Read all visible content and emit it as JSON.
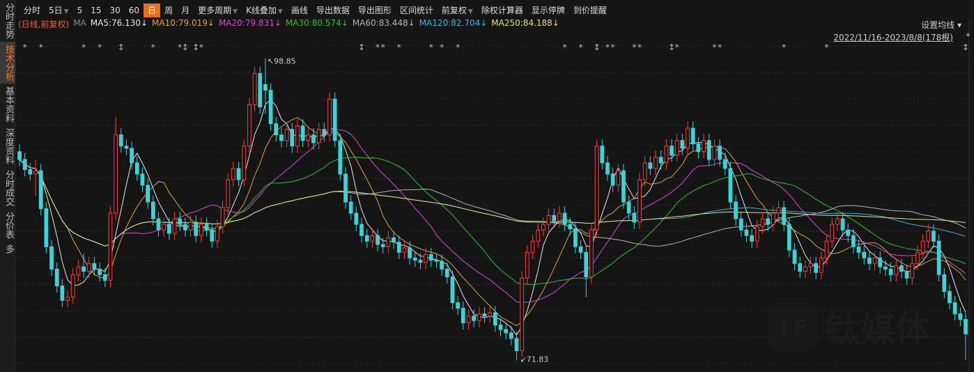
{
  "sidebar": {
    "items": [
      {
        "label": "分时走势",
        "active": false
      },
      {
        "label": "技术分析",
        "active": true
      },
      {
        "label": "基本资料",
        "active": false
      },
      {
        "label": "深度资料",
        "active": false
      },
      {
        "label": "分时成交",
        "active": false
      },
      {
        "label": "分价表",
        "active": false
      },
      {
        "label": "多",
        "active": false
      }
    ]
  },
  "toolbar": {
    "items": [
      {
        "label": "分时"
      },
      {
        "label": "5日",
        "dropdown": true
      },
      {
        "label": "5"
      },
      {
        "label": "15"
      },
      {
        "label": "30"
      },
      {
        "label": "60"
      },
      {
        "label": "日",
        "active": true
      },
      {
        "label": "周"
      },
      {
        "label": "月"
      },
      {
        "label": "更多周期",
        "dropdown": true
      },
      {
        "label": "K线叠加",
        "dropdown": true
      },
      {
        "label": "画线"
      },
      {
        "label": "导出数据"
      },
      {
        "label": "导出图形"
      },
      {
        "label": "区间统计"
      },
      {
        "label": "前复权",
        "dropdown": true
      },
      {
        "label": "除权计算器"
      },
      {
        "label": "显示停牌"
      },
      {
        "label": "到价提醒"
      }
    ]
  },
  "legend": {
    "mode": "(日线,前复权)",
    "ma_label": "MA",
    "items": [
      {
        "label": "MA5:76.130↓",
        "color": "#e8e8e8",
        "period": 5
      },
      {
        "label": "MA10:79.019↓",
        "color": "#d8a63a",
        "period": 10
      },
      {
        "label": "MA20:79.831↓",
        "color": "#d44ad4",
        "period": 20
      },
      {
        "label": "MA30:80.574↓",
        "color": "#2fbf2f",
        "period": 30
      },
      {
        "label": "MA60:83.448↓",
        "color": "#b4b4b4",
        "period": 60
      },
      {
        "label": "MA120:82.704↓",
        "color": "#2ab6d8",
        "period": 120
      },
      {
        "label": "MA250:84.188↓",
        "color": "#e6de7a",
        "period": 250
      }
    ]
  },
  "set_ma": "设置均线 ▾",
  "date_range": "2022/11/16-2023/8/8(178根)",
  "watermark": "钛媒体",
  "colors": {
    "up": "#ff3b3b",
    "down": "#3dd3d6",
    "bg": "#151515",
    "grid": "#2e2e2e"
  },
  "chart_data": {
    "type": "candlestick",
    "title": "",
    "bars": 178,
    "ylim": [
      70.8,
      100.2
    ],
    "grid": true,
    "annotations": [
      {
        "bar": 46,
        "label": "98.85",
        "kind": "high"
      },
      {
        "bar": 93,
        "label": "71.83",
        "kind": "low"
      }
    ],
    "event_markers": [
      {
        "bar": 1,
        "g": "*"
      },
      {
        "bar": 4,
        "g": "*"
      },
      {
        "bar": 12,
        "g": "*"
      },
      {
        "bar": 15,
        "g": "*"
      },
      {
        "bar": 19,
        "g": "↕"
      },
      {
        "bar": 25,
        "g": "*"
      },
      {
        "bar": 30,
        "g": "*"
      },
      {
        "bar": 31,
        "g": "↕"
      },
      {
        "bar": 33,
        "g": "↕"
      },
      {
        "bar": 34,
        "g": "*"
      },
      {
        "bar": 64,
        "g": "↕"
      },
      {
        "bar": 67,
        "g": "*"
      },
      {
        "bar": 68,
        "g": "*"
      },
      {
        "bar": 71,
        "g": "*"
      },
      {
        "bar": 77,
        "g": "*"
      },
      {
        "bar": 79,
        "g": "*"
      },
      {
        "bar": 82,
        "g": "*"
      },
      {
        "bar": 102,
        "g": "*"
      },
      {
        "bar": 105,
        "g": "*"
      },
      {
        "bar": 108,
        "g": "↕"
      },
      {
        "bar": 110,
        "g": "*"
      },
      {
        "bar": 111,
        "g": "*"
      },
      {
        "bar": 115,
        "g": "*"
      },
      {
        "bar": 116,
        "g": "*"
      },
      {
        "bar": 122,
        "g": "↕"
      },
      {
        "bar": 123,
        "g": "*"
      },
      {
        "bar": 130,
        "g": "*"
      },
      {
        "bar": 131,
        "g": "*"
      },
      {
        "bar": 143,
        "g": "*"
      },
      {
        "bar": 151,
        "g": "*"
      },
      {
        "bar": 177,
        "g": "↕"
      }
    ],
    "ohlc": [
      [
        90.5,
        91.2,
        89.2,
        89.8
      ],
      [
        89.8,
        90.4,
        88.3,
        88.9
      ],
      [
        88.9,
        89.5,
        87.9,
        88.5
      ],
      [
        88.5,
        89.8,
        86.5,
        88.8
      ],
      [
        88.8,
        89.4,
        84.8,
        85.4
      ],
      [
        85.4,
        86,
        81.4,
        82
      ],
      [
        82,
        82.6,
        79.4,
        80
      ],
      [
        80,
        80.6,
        77.9,
        78.5
      ],
      [
        78.5,
        79.1,
        76.6,
        77.2
      ],
      [
        77.2,
        78.1,
        76.6,
        77.5
      ],
      [
        77.5,
        80.1,
        76.9,
        79.5
      ],
      [
        79.5,
        80.8,
        78.9,
        80.2
      ],
      [
        80.2,
        81.4,
        79.2,
        79.8
      ],
      [
        79.8,
        81.1,
        79.2,
        80.5
      ],
      [
        80.5,
        81.1,
        79.4,
        80
      ],
      [
        80,
        80.6,
        78.9,
        79.5
      ],
      [
        79.5,
        80.1,
        78.4,
        79
      ],
      [
        79,
        85.6,
        78.4,
        85
      ],
      [
        85,
        93.6,
        84.4,
        92
      ],
      [
        92,
        92.6,
        90.4,
        91
      ],
      [
        91,
        91.6,
        90.2,
        90.8
      ],
      [
        90.8,
        91.4,
        88.9,
        89.5
      ],
      [
        89.5,
        90.1,
        87.9,
        88.5
      ],
      [
        88.5,
        89.1,
        86.9,
        87.5
      ],
      [
        87.5,
        88.1,
        85.4,
        86
      ],
      [
        86,
        86.6,
        83.9,
        84.5
      ],
      [
        84.5,
        85.1,
        82.9,
        83.5
      ],
      [
        83.5,
        84.6,
        82.9,
        84
      ],
      [
        84,
        84.6,
        82.6,
        83.2
      ],
      [
        83.2,
        85.1,
        82.6,
        84.5
      ],
      [
        84.5,
        85.1,
        83.4,
        84
      ],
      [
        84,
        84.6,
        82.9,
        83.5
      ],
      [
        83.5,
        84.8,
        82.9,
        84.2
      ],
      [
        84.2,
        84.8,
        82.4,
        83
      ],
      [
        83,
        84.6,
        82.4,
        84
      ],
      [
        84,
        84.6,
        82.9,
        83.5
      ],
      [
        83.5,
        84.1,
        81.9,
        82.5
      ],
      [
        82.5,
        84.4,
        81.9,
        83.8
      ],
      [
        83.8,
        86.1,
        83.2,
        85.5
      ],
      [
        85.5,
        88.6,
        84.9,
        88
      ],
      [
        88,
        89.6,
        87.4,
        89
      ],
      [
        89,
        89.6,
        87.4,
        88
      ],
      [
        88,
        91.6,
        87.4,
        91
      ],
      [
        91,
        95.3,
        90.4,
        94.7
      ],
      [
        94.7,
        98.1,
        94.1,
        97.5
      ],
      [
        97.5,
        98.1,
        93.9,
        94.5
      ],
      [
        96.5,
        98.85,
        93.9,
        96
      ],
      [
        96,
        96.6,
        92.4,
        93
      ],
      [
        93,
        93.6,
        91.4,
        92
      ],
      [
        92,
        92.6,
        90.9,
        91.5
      ],
      [
        91.5,
        93.1,
        90.9,
        92.5
      ],
      [
        92.5,
        93.1,
        90.4,
        91
      ],
      [
        91,
        93.4,
        90.4,
        92.8
      ],
      [
        92.8,
        93.4,
        90.9,
        91.5
      ],
      [
        91.5,
        92.6,
        90.9,
        92
      ],
      [
        92,
        92.6,
        90.7,
        91.3
      ],
      [
        91.3,
        93.1,
        90.7,
        92.5
      ],
      [
        92.5,
        93.1,
        91.4,
        92
      ],
      [
        92,
        95.8,
        91.4,
        95.2
      ],
      [
        95.2,
        95.8,
        90.9,
        91.5
      ],
      [
        91.5,
        92.1,
        87.9,
        88.5
      ],
      [
        88.5,
        89.1,
        85.4,
        86
      ],
      [
        86,
        86.6,
        84.4,
        85
      ],
      [
        85,
        85.6,
        83.4,
        84
      ],
      [
        84,
        84.6,
        82.4,
        83
      ],
      [
        83,
        83.6,
        81.9,
        82.5
      ],
      [
        82.5,
        83.6,
        81.9,
        83
      ],
      [
        83,
        83.6,
        81.6,
        82.2
      ],
      [
        82.2,
        82.8,
        81.4,
        82
      ],
      [
        82,
        83.4,
        81.4,
        82.8
      ],
      [
        82.8,
        83.4,
        81.8,
        82.4
      ],
      [
        82.4,
        83,
        80.9,
        81.5
      ],
      [
        81.5,
        82.5,
        80.9,
        81.9
      ],
      [
        81.9,
        82.5,
        80.4,
        81
      ],
      [
        81,
        81.6,
        80.2,
        80.8
      ],
      [
        80.8,
        81.4,
        80,
        80.6
      ],
      [
        80.6,
        81.9,
        80,
        81.3
      ],
      [
        81.3,
        81.9,
        80.2,
        80.8
      ],
      [
        80.8,
        81.4,
        80.1,
        80.7
      ],
      [
        80.7,
        81.3,
        79.4,
        80
      ],
      [
        80,
        80.6,
        78.7,
        79.3
      ],
      [
        79.3,
        79.9,
        76.4,
        77
      ],
      [
        77,
        77.6,
        75.9,
        76.5
      ],
      [
        76.5,
        77.1,
        74.6,
        75.2
      ],
      [
        75.2,
        76.4,
        74.6,
        75.8
      ],
      [
        75.8,
        76.4,
        74.8,
        75.4
      ],
      [
        75.4,
        76.6,
        74.8,
        76
      ],
      [
        76,
        76.6,
        75.2,
        75.8
      ],
      [
        75.8,
        76.7,
        75.2,
        76.1
      ],
      [
        76.1,
        76.7,
        74.4,
        75
      ],
      [
        75,
        75.6,
        74,
        74.6
      ],
      [
        74.6,
        75.2,
        73.7,
        74.3
      ],
      [
        74.3,
        74.9,
        73.2,
        73.8
      ],
      [
        73.8,
        74.4,
        71.83,
        72.7
      ],
      [
        72.7,
        79.8,
        72.1,
        79.2
      ],
      [
        79.2,
        82.1,
        78.6,
        81.5
      ],
      [
        81.5,
        83.1,
        80.9,
        82.5
      ],
      [
        82.5,
        84.1,
        81.9,
        83.5
      ],
      [
        83.5,
        84.6,
        82.9,
        84
      ],
      [
        84,
        85.4,
        83.4,
        84.8
      ],
      [
        84.8,
        85.4,
        83.7,
        84.3
      ],
      [
        84.3,
        85.6,
        83.7,
        85
      ],
      [
        85,
        85.6,
        83.4,
        84
      ],
      [
        84,
        84.6,
        83,
        83.6
      ],
      [
        83.6,
        84.2,
        81.4,
        82
      ],
      [
        82,
        82.6,
        80.9,
        81.5
      ],
      [
        81.5,
        82.1,
        77.5,
        79.3
      ],
      [
        79.3,
        84.1,
        78.7,
        83.5
      ],
      [
        83.5,
        91.6,
        82.9,
        91
      ],
      [
        91,
        91.6,
        88.9,
        89.5
      ],
      [
        89.5,
        90.1,
        87.9,
        88.5
      ],
      [
        88.5,
        89.1,
        86.9,
        87.5
      ],
      [
        87.5,
        89.4,
        86.9,
        88.8
      ],
      [
        88.8,
        89.4,
        85.4,
        86
      ],
      [
        86,
        86.6,
        84.4,
        85
      ],
      [
        85,
        85.6,
        83.6,
        84.2
      ],
      [
        84.2,
        88.6,
        83.6,
        88
      ],
      [
        88,
        90.1,
        87.4,
        89.5
      ],
      [
        89.5,
        90.1,
        88.4,
        89
      ],
      [
        89,
        90.6,
        88.4,
        90
      ],
      [
        90,
        90.6,
        88.9,
        89.5
      ],
      [
        89.5,
        91.6,
        88.9,
        91
      ],
      [
        91,
        91.6,
        89.6,
        90.2
      ],
      [
        90.2,
        92.1,
        89.6,
        91.5
      ],
      [
        91.5,
        92.1,
        90.2,
        90.8
      ],
      [
        90.8,
        93.2,
        90.2,
        92.6
      ],
      [
        92.6,
        93.2,
        90.6,
        91.2
      ],
      [
        91.2,
        91.8,
        89.9,
        90.5
      ],
      [
        90.5,
        92.1,
        89.9,
        91.5
      ],
      [
        91.5,
        92.1,
        89.2,
        89.8
      ],
      [
        89.8,
        91.6,
        89.2,
        91
      ],
      [
        91,
        91.6,
        89.2,
        89.8
      ],
      [
        89.8,
        90.4,
        88.4,
        89
      ],
      [
        89,
        89.6,
        85.4,
        86
      ],
      [
        86,
        86.6,
        83.9,
        84.5
      ],
      [
        84.5,
        85.1,
        82.9,
        83.5
      ],
      [
        83.5,
        84.1,
        82.4,
        83
      ],
      [
        83,
        83.6,
        81.9,
        82.5
      ],
      [
        82.5,
        84.4,
        81.9,
        83.8
      ],
      [
        83.8,
        85.1,
        83.2,
        84.5
      ],
      [
        84.5,
        85.1,
        83.4,
        84
      ],
      [
        84,
        85.6,
        83.4,
        85
      ],
      [
        85,
        86.1,
        84.4,
        85.5
      ],
      [
        85.5,
        86.1,
        83.4,
        84
      ],
      [
        84,
        84.6,
        81.1,
        81.7
      ],
      [
        81.7,
        82.3,
        79.9,
        80.5
      ],
      [
        80.5,
        81.1,
        79.2,
        79.8
      ],
      [
        79.8,
        80.8,
        79.2,
        80.2
      ],
      [
        80.2,
        81.1,
        79.6,
        80.5
      ],
      [
        80.5,
        81.1,
        79.1,
        79.7
      ],
      [
        79.7,
        81.6,
        79.1,
        81
      ],
      [
        81,
        83.1,
        80.4,
        82.5
      ],
      [
        82.5,
        84.6,
        81.9,
        84
      ],
      [
        84,
        85.1,
        83.4,
        84.5
      ],
      [
        84.5,
        85.1,
        82.9,
        83.5
      ],
      [
        83.5,
        84.1,
        82.4,
        83
      ],
      [
        83,
        83.6,
        81.4,
        82
      ],
      [
        82,
        82.6,
        80.9,
        81.5
      ],
      [
        81.5,
        82.1,
        80.4,
        81
      ],
      [
        81,
        81.6,
        79.9,
        80.5
      ],
      [
        80.5,
        81.6,
        79.9,
        81
      ],
      [
        81,
        81.6,
        79.6,
        80.2
      ],
      [
        80.2,
        80.8,
        79.4,
        80
      ],
      [
        80,
        80.6,
        78.9,
        79.5
      ],
      [
        79.5,
        80.9,
        78.9,
        80.3
      ],
      [
        80.3,
        80.9,
        79.2,
        79.8
      ],
      [
        79.8,
        80.4,
        78.6,
        79.2
      ],
      [
        79.2,
        81.1,
        78.6,
        80.5
      ],
      [
        80.5,
        82.1,
        79.9,
        81.5
      ],
      [
        81.5,
        83.1,
        80.9,
        82.5
      ],
      [
        82.5,
        84,
        81.9,
        83.4
      ],
      [
        83.4,
        84,
        81.9,
        82.5
      ],
      [
        82.5,
        83.1,
        78.9,
        79.5
      ],
      [
        79.5,
        80.1,
        77.4,
        78
      ],
      [
        78,
        78.6,
        76.4,
        77
      ],
      [
        77,
        77.6,
        75.4,
        76
      ],
      [
        76,
        76.6,
        74.9,
        75.5
      ],
      [
        75.5,
        76.1,
        71.9,
        74.2
      ]
    ]
  }
}
